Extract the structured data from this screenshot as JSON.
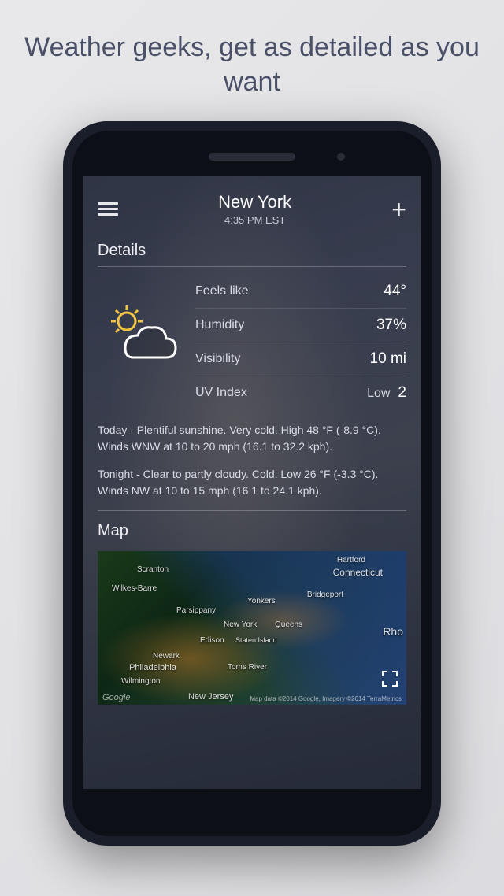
{
  "promo": {
    "tagline": "Weather geeks, get as detailed as you want"
  },
  "header": {
    "city": "New York",
    "time": "4:35 PM EST"
  },
  "details": {
    "title": "Details",
    "rows": [
      {
        "label": "Feels like",
        "value": "44°"
      },
      {
        "label": "Humidity",
        "value": "37%"
      },
      {
        "label": "Visibility",
        "value": "10 mi"
      },
      {
        "label": "UV Index",
        "word": "Low",
        "value": "2"
      }
    ]
  },
  "forecast": {
    "today": "Today - Plentiful sunshine. Very cold. High 48 °F (-8.9 °C). Winds WNW at 10 to 20 mph (16.1 to 32.2 kph).",
    "tonight": "Tonight - Clear to partly cloudy. Cold. Low 26 °F (-3.3 °C). Winds NW at 10 to 15 mph (16.1 to 24.1 kph)."
  },
  "map": {
    "title": "Map",
    "labels": {
      "hartford": "Hartford",
      "connecticut": "Connecticut",
      "scranton": "Scranton",
      "wilkesbarre": "Wilkes-Barre",
      "parsippany": "Parsippany",
      "yonkers": "Yonkers",
      "bridgeport": "Bridgeport",
      "newyork": "New York",
      "queens": "Queens",
      "edison": "Edison",
      "statenisland": "Staten Island",
      "newark": "Newark",
      "philadelphia": "Philadelphia",
      "wilmington": "Wilmington",
      "tomsriver": "Toms River",
      "newjersey": "New Jersey",
      "rho": "Rho"
    },
    "attribution_left": "Google",
    "attribution_right": "Map data ©2014 Google, Imagery ©2014 TerraMetrics"
  }
}
